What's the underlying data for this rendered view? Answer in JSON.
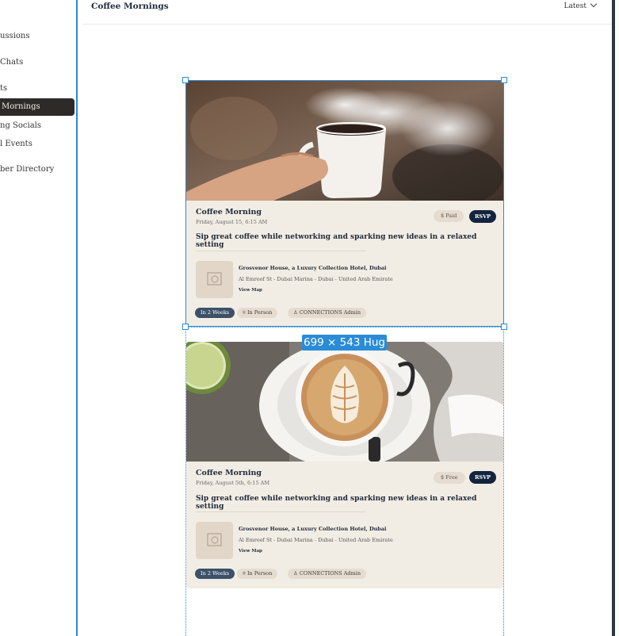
{
  "sidebar": {
    "items": [
      {
        "label": "ussions"
      },
      {
        "label": "Chats"
      },
      {
        "label": "ts"
      },
      {
        "label": "Mornings"
      },
      {
        "label": "ng Socials"
      },
      {
        "label": "l Events"
      },
      {
        "label": "ber Directory"
      }
    ]
  },
  "header": {
    "title": "Coffee Mornings",
    "sort_label": "Latest"
  },
  "selection": {
    "size_label": "699 × 543 Hug"
  },
  "cards": [
    {
      "image_icon": "coffee-cup-steam-photo",
      "title": "Coffee Morning",
      "date": "Friday, August 15, 6:15 AM",
      "price": "$ Paid",
      "rsvp": "RSVP",
      "description": "Sip great coffee while networking and sparking new ideas in a relaxed setting",
      "venue_name": "Grosvenor House, a Luxury Collection Hotel, Dubai",
      "venue_address": "Al Emreef St - Dubai Marina - Dubai - United Arab Emirate",
      "view_map": "View Map",
      "tags": [
        "In 2 Weeks",
        "In Person",
        "CONNECTIONS Admin"
      ]
    },
    {
      "image_icon": "latte-art-photo",
      "title": "Coffee Morning",
      "date": "Friday, August 5th, 6:15 AM",
      "price": "$ Free",
      "rsvp": "RSVP",
      "description": "Sip great coffee while networking and sparking new ideas in a relaxed setting",
      "venue_name": "Grosvenor House, a Luxury Collection Hotel, Dubai",
      "venue_address": "Al Emreef St - Dubai Marina - Dubai - United Arab Emirate",
      "view_map": "View Map",
      "tags": [
        "In 2 Weeks",
        "In Person",
        "CONNECTIONS Admin"
      ]
    }
  ],
  "colors": {
    "accent": "#2a8bd6",
    "active_nav": "#2d2a28",
    "card_bg": "#f2ede4",
    "rsvp": "#13243e",
    "tag_dark": "#3c5068"
  }
}
